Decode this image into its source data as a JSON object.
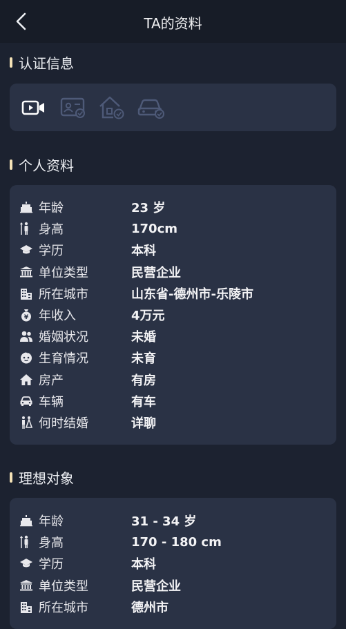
{
  "header": {
    "title": "TA的资料",
    "back_icon": "chevron-left-icon"
  },
  "colors": {
    "background": "#1c2230",
    "header": "#171c27",
    "card": "#2a3245",
    "accent": "#f4e2b6"
  },
  "sections": {
    "verification": {
      "title": "认证信息",
      "icons": [
        "video-verified-icon",
        "id-card-verified-icon",
        "house-verified-icon",
        "car-verified-icon"
      ]
    },
    "profile": {
      "title": "个人资料",
      "rows": [
        {
          "icon": "cake-icon",
          "label": "年龄",
          "value": "23 岁"
        },
        {
          "icon": "height-icon",
          "label": "身高",
          "value": "170cm"
        },
        {
          "icon": "graduation-cap-icon",
          "label": "学历",
          "value": "本科"
        },
        {
          "icon": "institution-icon",
          "label": "单位类型",
          "value": "民营企业"
        },
        {
          "icon": "city-building-icon",
          "label": "所在城市",
          "value": "山东省-德州市-乐陵市"
        },
        {
          "icon": "money-bag-icon",
          "label": "年收入",
          "value": "4万元"
        },
        {
          "icon": "couple-icon",
          "label": "婚姻状况",
          "value": "未婚"
        },
        {
          "icon": "baby-face-icon",
          "label": "生育情况",
          "value": "未育"
        },
        {
          "icon": "house-icon",
          "label": "房产",
          "value": "有房"
        },
        {
          "icon": "car-icon",
          "label": "车辆",
          "value": "有车"
        },
        {
          "icon": "wedding-couple-icon",
          "label": "何时结婚",
          "value": "详聊"
        }
      ]
    },
    "ideal": {
      "title": "理想对象",
      "rows": [
        {
          "icon": "cake-icon",
          "label": "年龄",
          "value": "31 - 34 岁"
        },
        {
          "icon": "height-icon",
          "label": "身高",
          "value": "170 - 180 cm"
        },
        {
          "icon": "graduation-cap-icon",
          "label": "学历",
          "value": "本科"
        },
        {
          "icon": "institution-icon",
          "label": "单位类型",
          "value": "民营企业"
        },
        {
          "icon": "city-building-icon",
          "label": "所在城市",
          "value": "德州市"
        }
      ]
    }
  }
}
